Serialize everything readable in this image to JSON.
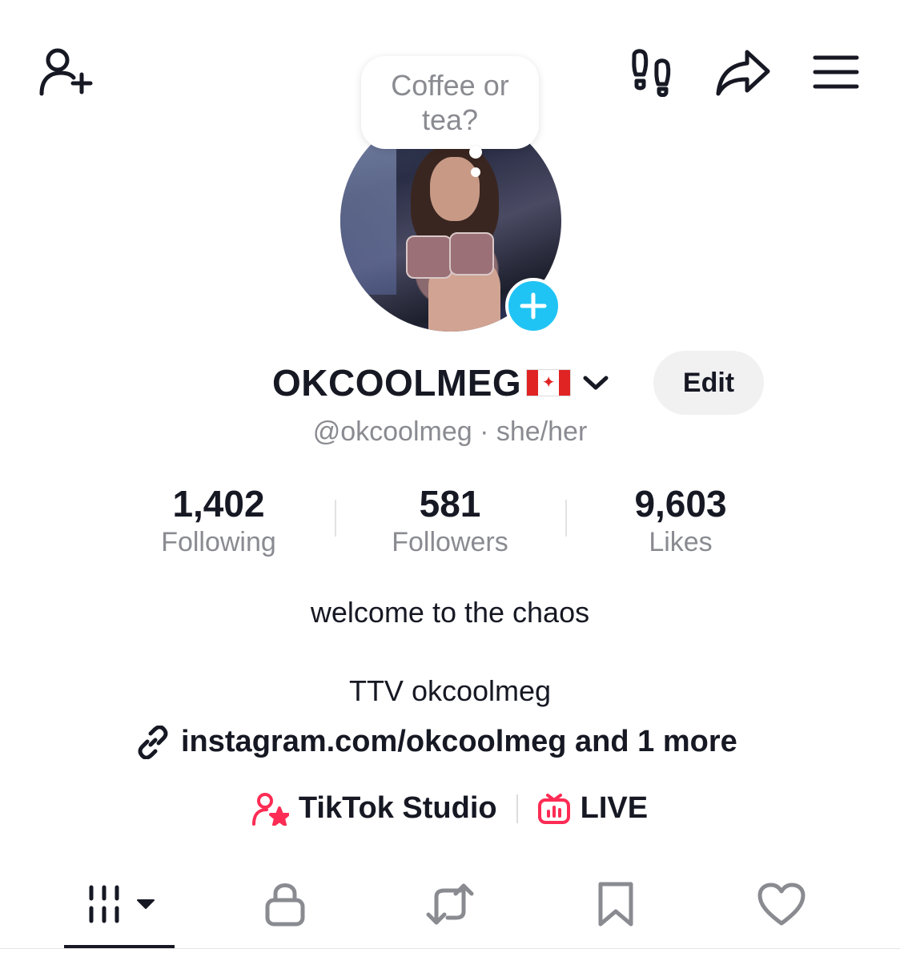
{
  "header": {
    "icons": [
      "add-friend-icon",
      "footprints-icon",
      "share-icon",
      "menu-icon"
    ]
  },
  "avatar": {
    "bubble_text": "Coffee or tea?",
    "add_icon": "plus-icon",
    "add_color": "#20c4f4"
  },
  "profile": {
    "display_name": "OKCOOLMEG",
    "flag": "🇨🇦",
    "edit_label": "Edit",
    "handle_line": "@okcoolmeg · she/her"
  },
  "stats": [
    {
      "value": "1,402",
      "label": "Following"
    },
    {
      "value": "581",
      "label": "Followers"
    },
    {
      "value": "9,603",
      "label": "Likes"
    }
  ],
  "bio": {
    "line1": "welcome to the chaos",
    "line2": "TTV okcoolmeg",
    "link": "instagram.com/okcoolmeg and 1 more"
  },
  "tools": [
    {
      "label": "TikTok Studio",
      "icon": "creator-star-icon"
    },
    {
      "label": "LIVE",
      "icon": "live-tv-icon"
    }
  ],
  "tabs": [
    {
      "name": "videos",
      "icon": "grid-icon",
      "active": true
    },
    {
      "name": "private",
      "icon": "lock-icon"
    },
    {
      "name": "reposts",
      "icon": "repost-icon"
    },
    {
      "name": "favorites",
      "icon": "bookmark-icon"
    },
    {
      "name": "liked",
      "icon": "heart-icon"
    }
  ],
  "colors": {
    "text": "#161823",
    "secondary_text": "#8a8b91",
    "accent_pink": "#fe2c55",
    "accent_blue": "#20c4f4"
  }
}
